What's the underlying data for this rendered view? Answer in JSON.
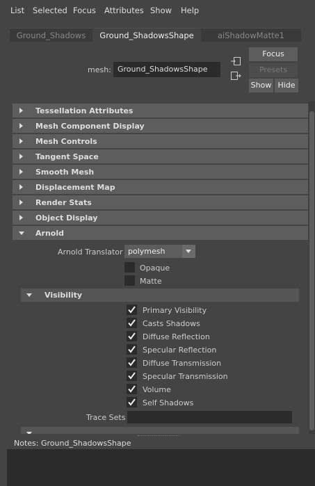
{
  "menubar": {
    "items": [
      "List",
      "Selected",
      "Focus",
      "Attributes",
      "Show",
      "Help"
    ]
  },
  "tabs": [
    {
      "label": "Ground_Shadows",
      "active": false
    },
    {
      "label": "Ground_ShadowsShape",
      "active": true
    },
    {
      "label": "aiShadowMatte1",
      "active": false
    }
  ],
  "node": {
    "label": "mesh:",
    "value": "Ground_ShadowsShape"
  },
  "buttons": {
    "focus": "Focus",
    "presets": "Presets",
    "show": "Show",
    "hide": "Hide"
  },
  "sections": [
    {
      "label": "Tessellation Attributes",
      "expanded": false
    },
    {
      "label": "Mesh Component Display",
      "expanded": false
    },
    {
      "label": "Mesh Controls",
      "expanded": false
    },
    {
      "label": "Tangent Space",
      "expanded": false
    },
    {
      "label": "Smooth Mesh",
      "expanded": false
    },
    {
      "label": "Displacement Map",
      "expanded": false
    },
    {
      "label": "Render Stats",
      "expanded": false
    },
    {
      "label": "Object Display",
      "expanded": false
    },
    {
      "label": "Arnold",
      "expanded": true
    }
  ],
  "arnold": {
    "translator_label": "Arnold Translator",
    "translator_value": "polymesh",
    "opaque": {
      "label": "Opaque",
      "checked": false
    },
    "matte": {
      "label": "Matte",
      "checked": false
    },
    "visibility_header": "Visibility",
    "visibility": [
      {
        "label": "Primary Visibility",
        "checked": true
      },
      {
        "label": "Casts Shadows",
        "checked": true
      },
      {
        "label": "Diffuse Reflection",
        "checked": true
      },
      {
        "label": "Specular Reflection",
        "checked": true
      },
      {
        "label": "Diffuse Transmission",
        "checked": true
      },
      {
        "label": "Specular Transmission",
        "checked": true
      },
      {
        "label": "Volume",
        "checked": true
      },
      {
        "label": "Self Shadows",
        "checked": true
      }
    ],
    "trace_sets_label": "Trace Sets",
    "trace_sets_value": ""
  },
  "notes": {
    "label": "Notes:  Ground_ShadowsShape",
    "value": ""
  }
}
